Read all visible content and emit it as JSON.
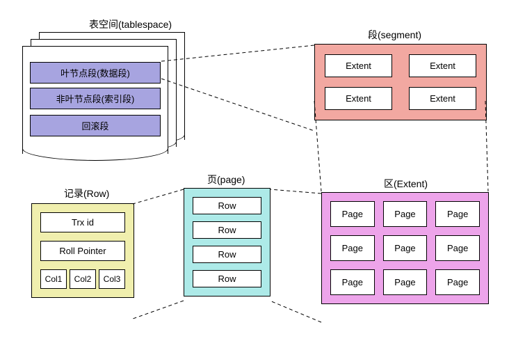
{
  "tablespace": {
    "title": "表空间(tablespace)",
    "segments": [
      "叶节点段(数据段)",
      "非叶节点段(索引段)",
      "回滚段"
    ]
  },
  "segment": {
    "title": "段(segment)",
    "cells": [
      "Extent",
      "Extent",
      "Extent",
      "Extent"
    ]
  },
  "extent": {
    "title": "区(Extent)",
    "cells": [
      "Page",
      "Page",
      "Page",
      "Page",
      "Page",
      "Page",
      "Page",
      "Page",
      "Page"
    ]
  },
  "page": {
    "title": "页(page)",
    "rows": [
      "Row",
      "Row",
      "Row",
      "Row"
    ]
  },
  "row": {
    "title": "记录(Row)",
    "trx": "Trx id",
    "roll": "Roll Pointer",
    "cols": [
      "Col1",
      "Col2",
      "Col3"
    ]
  }
}
